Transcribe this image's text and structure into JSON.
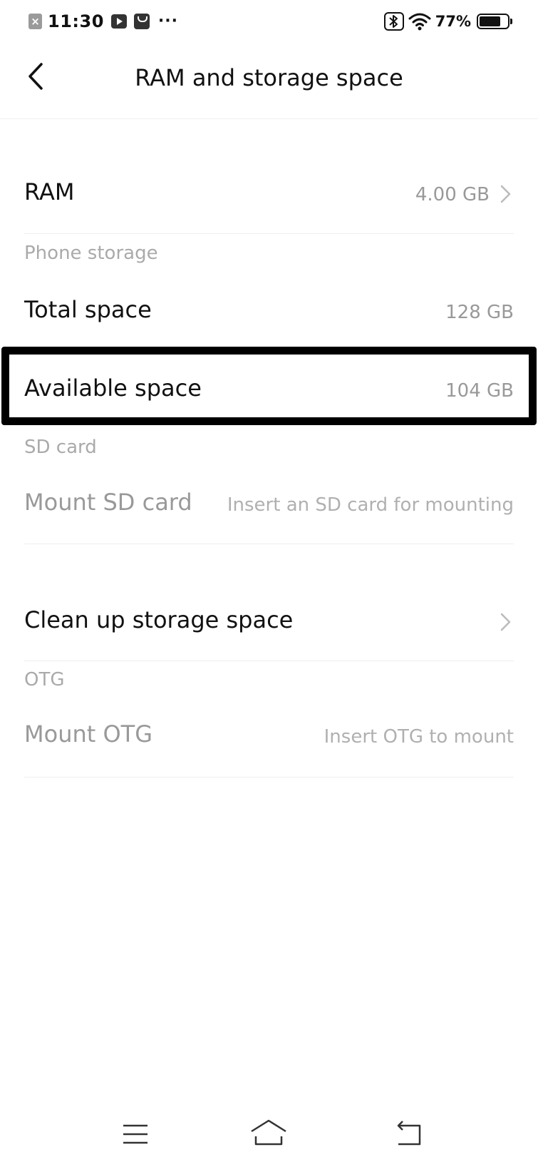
{
  "status_bar": {
    "time": "11:30",
    "dots": "···",
    "battery_percent_label": "77%",
    "battery_level": 0.77,
    "icons": [
      "close-notification-icon",
      "video-app-icon",
      "bag-app-icon",
      "bluetooth-icon",
      "wifi-icon",
      "battery-icon"
    ]
  },
  "header": {
    "title": "RAM and storage space",
    "back_icon": "chevron-left-icon"
  },
  "ram": {
    "label": "RAM",
    "value": "4.00 GB"
  },
  "phone_storage": {
    "section_label": "Phone storage",
    "total": {
      "label": "Total space",
      "value": "128 GB"
    },
    "available": {
      "label": "Available space",
      "value": "104 GB"
    }
  },
  "sd_card": {
    "section_label": "SD card",
    "mount": {
      "label": "Mount SD card",
      "value": "Insert an SD card for mounting"
    }
  },
  "cleanup": {
    "label": "Clean up storage space"
  },
  "otg": {
    "section_label": "OTG",
    "mount": {
      "label": "Mount OTG",
      "value": "Insert OTG to mount"
    }
  },
  "navbar": {
    "icons": [
      "menu-icon",
      "home-icon",
      "back-icon"
    ]
  },
  "colors": {
    "text_primary": "#111111",
    "text_secondary": "#999999",
    "section_label": "#aaaaaa",
    "divider": "#eeeeee",
    "highlight_border": "#000000"
  }
}
